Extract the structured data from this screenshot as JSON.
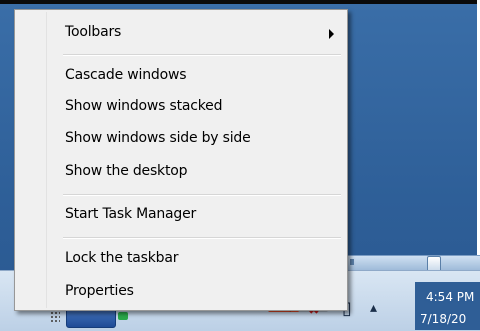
{
  "context_menu": {
    "items": [
      {
        "label": "Toolbars",
        "has_submenu": true
      },
      {
        "label": "Cascade windows"
      },
      {
        "label": "Show windows stacked"
      },
      {
        "label": "Show windows side by side"
      },
      {
        "label": "Show the desktop"
      },
      {
        "label": "Start Task Manager"
      },
      {
        "label": "Lock the taskbar"
      },
      {
        "label": "Properties"
      }
    ]
  },
  "taskbar": {
    "clock_time": "4:54 PM",
    "clock_date": "7/18/20",
    "tray_icons": [
      "up-arrow-icon",
      "volume-icon",
      "network-error-icon",
      "speaker-icon",
      "action-center-icon"
    ]
  },
  "colors": {
    "desktop": "#3a6ea8",
    "menu_bg": "#f0f0f0",
    "taskbar": "#c8d9ec"
  }
}
